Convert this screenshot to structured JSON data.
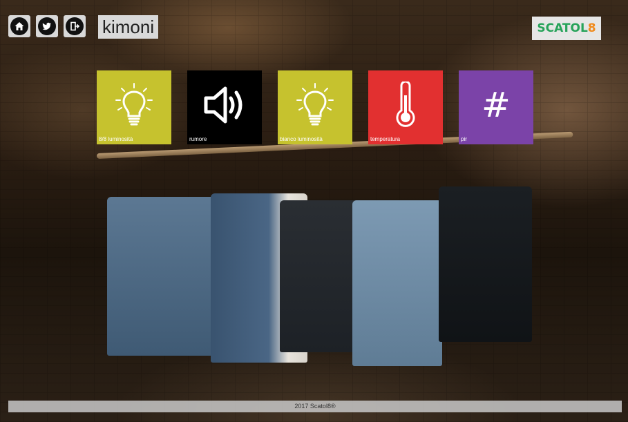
{
  "header": {
    "title": "kimoni",
    "buttons": [
      {
        "icon": "home-icon"
      },
      {
        "icon": "twitter-icon"
      },
      {
        "icon": "logout-icon"
      }
    ]
  },
  "logo": {
    "part1": "SCATOL",
    "part2": "8"
  },
  "tiles": [
    {
      "label": "8/8 luminosità",
      "icon": "lightbulb-icon",
      "color": "#c6c22e"
    },
    {
      "label": "rumore",
      "icon": "speaker-icon",
      "color": "#000000"
    },
    {
      "label": "bianco luminosità",
      "icon": "lightbulb-icon",
      "color": "#c6c22e"
    },
    {
      "label": "temperatura",
      "icon": "thermometer-icon",
      "color": "#e23030"
    },
    {
      "label": "pir",
      "icon": "hash-icon",
      "color": "#7b43a8",
      "symbol": "#"
    }
  ],
  "footer": {
    "text": "2017 Scatol8®"
  }
}
